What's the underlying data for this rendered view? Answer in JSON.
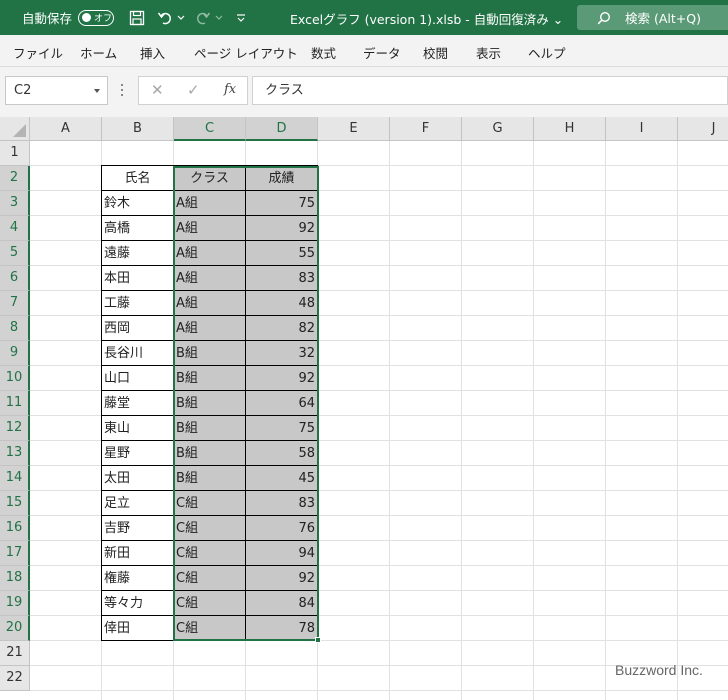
{
  "titlebar": {
    "autosave_label": "自動保存",
    "autosave_state": "オフ",
    "document_title": "Excelグラフ (version 1).xlsb  -  自動回復済み ⌄",
    "search_label": "検索 (Alt+Q)"
  },
  "ribbon_tabs": [
    "ファイル",
    "ホーム",
    "挿入",
    "ページ レイアウト",
    "数式",
    "データ",
    "校閲",
    "表示",
    "ヘルプ"
  ],
  "formula_bar": {
    "name_box": "C2",
    "cancel": "✕",
    "enter": "✓",
    "fx": "fx",
    "content": "クラス"
  },
  "columns": [
    "A",
    "B",
    "C",
    "D",
    "E",
    "F",
    "G",
    "H",
    "I",
    "J"
  ],
  "rows": [
    "1",
    "2",
    "3",
    "4",
    "5",
    "6",
    "7",
    "8",
    "9",
    "10",
    "11",
    "12",
    "13",
    "14",
    "15",
    "16",
    "17",
    "18",
    "19",
    "20",
    "21",
    "22"
  ],
  "table": {
    "headers": [
      "氏名",
      "クラス",
      "成績"
    ],
    "rows": [
      [
        "鈴木",
        "A組",
        "75"
      ],
      [
        "高橋",
        "A組",
        "92"
      ],
      [
        "遠藤",
        "A組",
        "55"
      ],
      [
        "本田",
        "A組",
        "83"
      ],
      [
        "工藤",
        "A組",
        "48"
      ],
      [
        "西岡",
        "A組",
        "82"
      ],
      [
        "長谷川",
        "B組",
        "32"
      ],
      [
        "山口",
        "B組",
        "92"
      ],
      [
        "藤堂",
        "B組",
        "64"
      ],
      [
        "東山",
        "B組",
        "75"
      ],
      [
        "星野",
        "B組",
        "58"
      ],
      [
        "太田",
        "B組",
        "45"
      ],
      [
        "足立",
        "C組",
        "83"
      ],
      [
        "吉野",
        "C組",
        "76"
      ],
      [
        "新田",
        "C組",
        "94"
      ],
      [
        "権藤",
        "C組",
        "92"
      ],
      [
        "等々力",
        "C組",
        "84"
      ],
      [
        "倖田",
        "C組",
        "78"
      ]
    ]
  },
  "watermark": "Buzzword Inc.",
  "colors": {
    "excel_green": "#217346",
    "selection_fill": "#c8c8c8"
  }
}
